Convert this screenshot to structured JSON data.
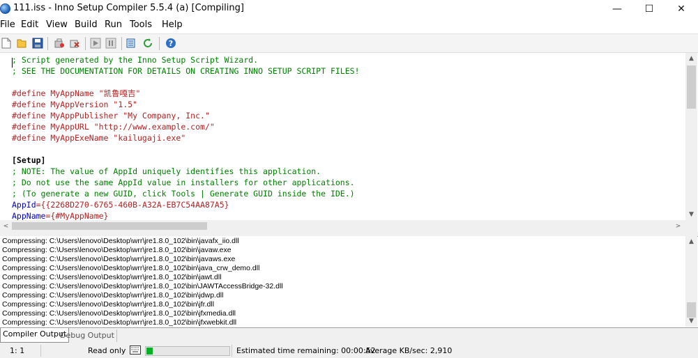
{
  "window": {
    "title": "111.iss - Inno Setup Compiler 5.5.4 (a)  [Compiling]",
    "minimize_glyph": "—",
    "maximize_glyph": "☐",
    "close_glyph": "✕"
  },
  "menu": [
    "File",
    "Edit",
    "View",
    "Build",
    "Run",
    "Tools",
    "Help"
  ],
  "toolbar": {
    "buttons": [
      "new-file-icon",
      "open-folder-icon",
      "save-icon",
      "compile-icon",
      "stop-compile-icon",
      "run-icon",
      "pause-icon",
      "target-options-icon",
      "refresh-icon",
      "help-icon"
    ]
  },
  "editor": {
    "lines": [
      {
        "text": "; Script generated by the Inno Setup Script Wizard.",
        "kind": "comment"
      },
      {
        "text": "; SEE THE DOCUMENTATION FOR DETAILS ON CREATING INNO SETUP SCRIPT FILES!",
        "kind": "comment"
      },
      {
        "text": "",
        "kind": "blank"
      },
      {
        "text": "#define MyAppName \"凯鲁嘎吉\"",
        "kind": "define"
      },
      {
        "text": "#define MyAppVersion \"1.5\"",
        "kind": "define"
      },
      {
        "text": "#define MyAppPublisher \"My Company, Inc.\"",
        "kind": "define"
      },
      {
        "text": "#define MyAppURL \"http://www.example.com/\"",
        "kind": "define"
      },
      {
        "text": "#define MyAppExeName \"kailugaji.exe\"",
        "kind": "define"
      },
      {
        "text": "",
        "kind": "blank"
      },
      {
        "text": "[Setup]",
        "kind": "section"
      },
      {
        "text": "; NOTE: The value of AppId uniquely identifies this application.",
        "kind": "comment"
      },
      {
        "text": "; Do not use the same AppId value in installers for other applications.",
        "kind": "comment"
      },
      {
        "text": "; (To generate a new GUID, click Tools | Generate GUID inside the IDE.)",
        "kind": "comment"
      },
      {
        "text": "AppId={{2268D270-6765-460B-A32A-EB7C54AA87A5}",
        "kind": "key",
        "key": "AppId",
        "value": "={{2268D270-6765-460B-A32A-EB7C54AA87A5}"
      },
      {
        "text": "AppName={#MyAppName}",
        "kind": "key",
        "key": "AppName",
        "value": "={#MyAppName}"
      }
    ]
  },
  "output": {
    "lines": [
      "Compressing: C:\\Users\\lenovo\\Desktop\\wrr\\jre1.8.0_102\\bin\\javafx_iio.dll",
      "Compressing: C:\\Users\\lenovo\\Desktop\\wrr\\jre1.8.0_102\\bin\\javaw.exe",
      "Compressing: C:\\Users\\lenovo\\Desktop\\wrr\\jre1.8.0_102\\bin\\javaws.exe",
      "Compressing: C:\\Users\\lenovo\\Desktop\\wrr\\jre1.8.0_102\\bin\\java_crw_demo.dll",
      "Compressing: C:\\Users\\lenovo\\Desktop\\wrr\\jre1.8.0_102\\bin\\jawt.dll",
      "Compressing: C:\\Users\\lenovo\\Desktop\\wrr\\jre1.8.0_102\\bin\\JAWTAccessBridge-32.dll",
      "Compressing: C:\\Users\\lenovo\\Desktop\\wrr\\jre1.8.0_102\\bin\\jdwp.dll",
      "Compressing: C:\\Users\\lenovo\\Desktop\\wrr\\jre1.8.0_102\\bin\\jfr.dll",
      "Compressing: C:\\Users\\lenovo\\Desktop\\wrr\\jre1.8.0_102\\bin\\jfxmedia.dll",
      "Compressing: C:\\Users\\lenovo\\Desktop\\wrr\\jre1.8.0_102\\bin\\jfxwebkit.dll"
    ]
  },
  "tabs": {
    "compiler_output": "Compiler Output",
    "debug_output": "Debug Output"
  },
  "status": {
    "position": "1:   1",
    "mode": "Read only",
    "progress_fraction": 0.08,
    "estimated": "Estimated time remaining: 00:00:52",
    "average": "Average KB/sec: 2,910"
  },
  "colors": {
    "comment": "#008000",
    "define": "#b22222",
    "key": "#0000cc",
    "progress": "#06b025"
  }
}
